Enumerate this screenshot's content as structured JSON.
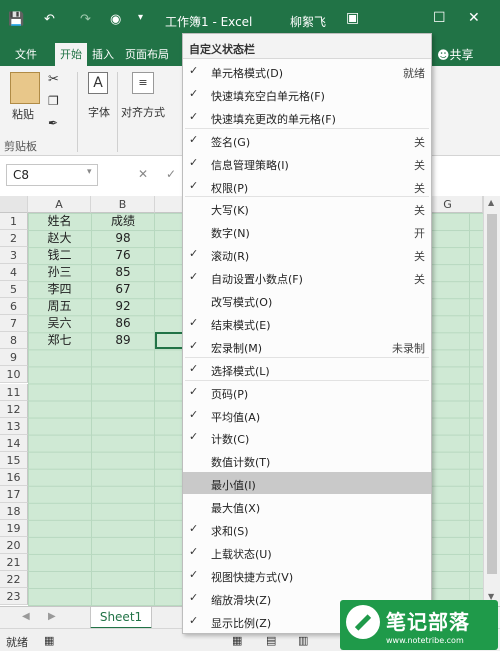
{
  "window": {
    "title": "工作簿1 - Excel",
    "user": "柳絮飞",
    "quick_access": [
      "save-icon",
      "undo-icon",
      "redo-icon",
      "camera-icon",
      "customize-icon"
    ]
  },
  "tabs": [
    {
      "label": "文件",
      "active": false
    },
    {
      "label": "开始",
      "active": true
    },
    {
      "label": "插入",
      "active": false
    },
    {
      "label": "页面布局",
      "active": false
    }
  ],
  "share_label": "共享",
  "ribbon": {
    "paste_label": "粘贴",
    "clipboard_label": "剪贴板",
    "font_label": "字体",
    "align_label": "对齐方式"
  },
  "formula_bar": {
    "name_box": "C8"
  },
  "columns": [
    "A",
    "B",
    "G"
  ],
  "rows": [
    "1",
    "2",
    "3",
    "4",
    "5",
    "6",
    "7",
    "8",
    "9",
    "10",
    "11",
    "12",
    "13",
    "14",
    "15",
    "16",
    "17",
    "18",
    "19",
    "20",
    "21",
    "22",
    "23"
  ],
  "table": {
    "headers": [
      "姓名",
      "成绩"
    ],
    "rows": [
      [
        "赵大",
        "98"
      ],
      [
        "钱二",
        "76"
      ],
      [
        "孙三",
        "85"
      ],
      [
        "李四",
        "67"
      ],
      [
        "周五",
        "92"
      ],
      [
        "吴六",
        "86"
      ],
      [
        "郑七",
        "89"
      ]
    ]
  },
  "sheet_tab": "Sheet1",
  "status_text": "就绪",
  "menu": {
    "title": "自定义状态栏",
    "items": [
      {
        "label": "单元格模式(D)",
        "checked": true,
        "value": "就绪"
      },
      {
        "label": "快速填充空白单元格(F)",
        "checked": true,
        "value": ""
      },
      {
        "label": "快速填充更改的单元格(F)",
        "checked": true,
        "value": ""
      },
      {
        "label": "签名(G)",
        "checked": true,
        "value": "关"
      },
      {
        "label": "信息管理策略(I)",
        "checked": true,
        "value": "关"
      },
      {
        "label": "权限(P)",
        "checked": true,
        "value": "关"
      },
      {
        "label": "大写(K)",
        "checked": false,
        "value": "关"
      },
      {
        "label": "数字(N)",
        "checked": false,
        "value": "开"
      },
      {
        "label": "滚动(R)",
        "checked": true,
        "value": "关"
      },
      {
        "label": "自动设置小数点(F)",
        "checked": true,
        "value": "关"
      },
      {
        "label": "改写模式(O)",
        "checked": false,
        "value": ""
      },
      {
        "label": "结束模式(E)",
        "checked": true,
        "value": ""
      },
      {
        "label": "宏录制(M)",
        "checked": true,
        "value": "未录制"
      },
      {
        "label": "选择模式(L)",
        "checked": true,
        "value": ""
      },
      {
        "label": "页码(P)",
        "checked": true,
        "value": ""
      },
      {
        "label": "平均值(A)",
        "checked": true,
        "value": ""
      },
      {
        "label": "计数(C)",
        "checked": true,
        "value": ""
      },
      {
        "label": "数值计数(T)",
        "checked": false,
        "value": ""
      },
      {
        "label": "最小值(I)",
        "checked": false,
        "value": "",
        "highlighted": true
      },
      {
        "label": "最大值(X)",
        "checked": false,
        "value": ""
      },
      {
        "label": "求和(S)",
        "checked": true,
        "value": ""
      },
      {
        "label": "上载状态(U)",
        "checked": true,
        "value": ""
      },
      {
        "label": "视图快捷方式(V)",
        "checked": true,
        "value": ""
      },
      {
        "label": "缩放滑块(Z)",
        "checked": true,
        "value": ""
      },
      {
        "label": "显示比例(Z)",
        "checked": true,
        "value": ""
      }
    ]
  },
  "watermark": {
    "title": "笔记部落",
    "subtitle": "www.notetribe.com"
  },
  "colors": {
    "excel_green": "#217346",
    "selection_fill": "#cfe9d4",
    "watermark": "#1f9a4a"
  }
}
